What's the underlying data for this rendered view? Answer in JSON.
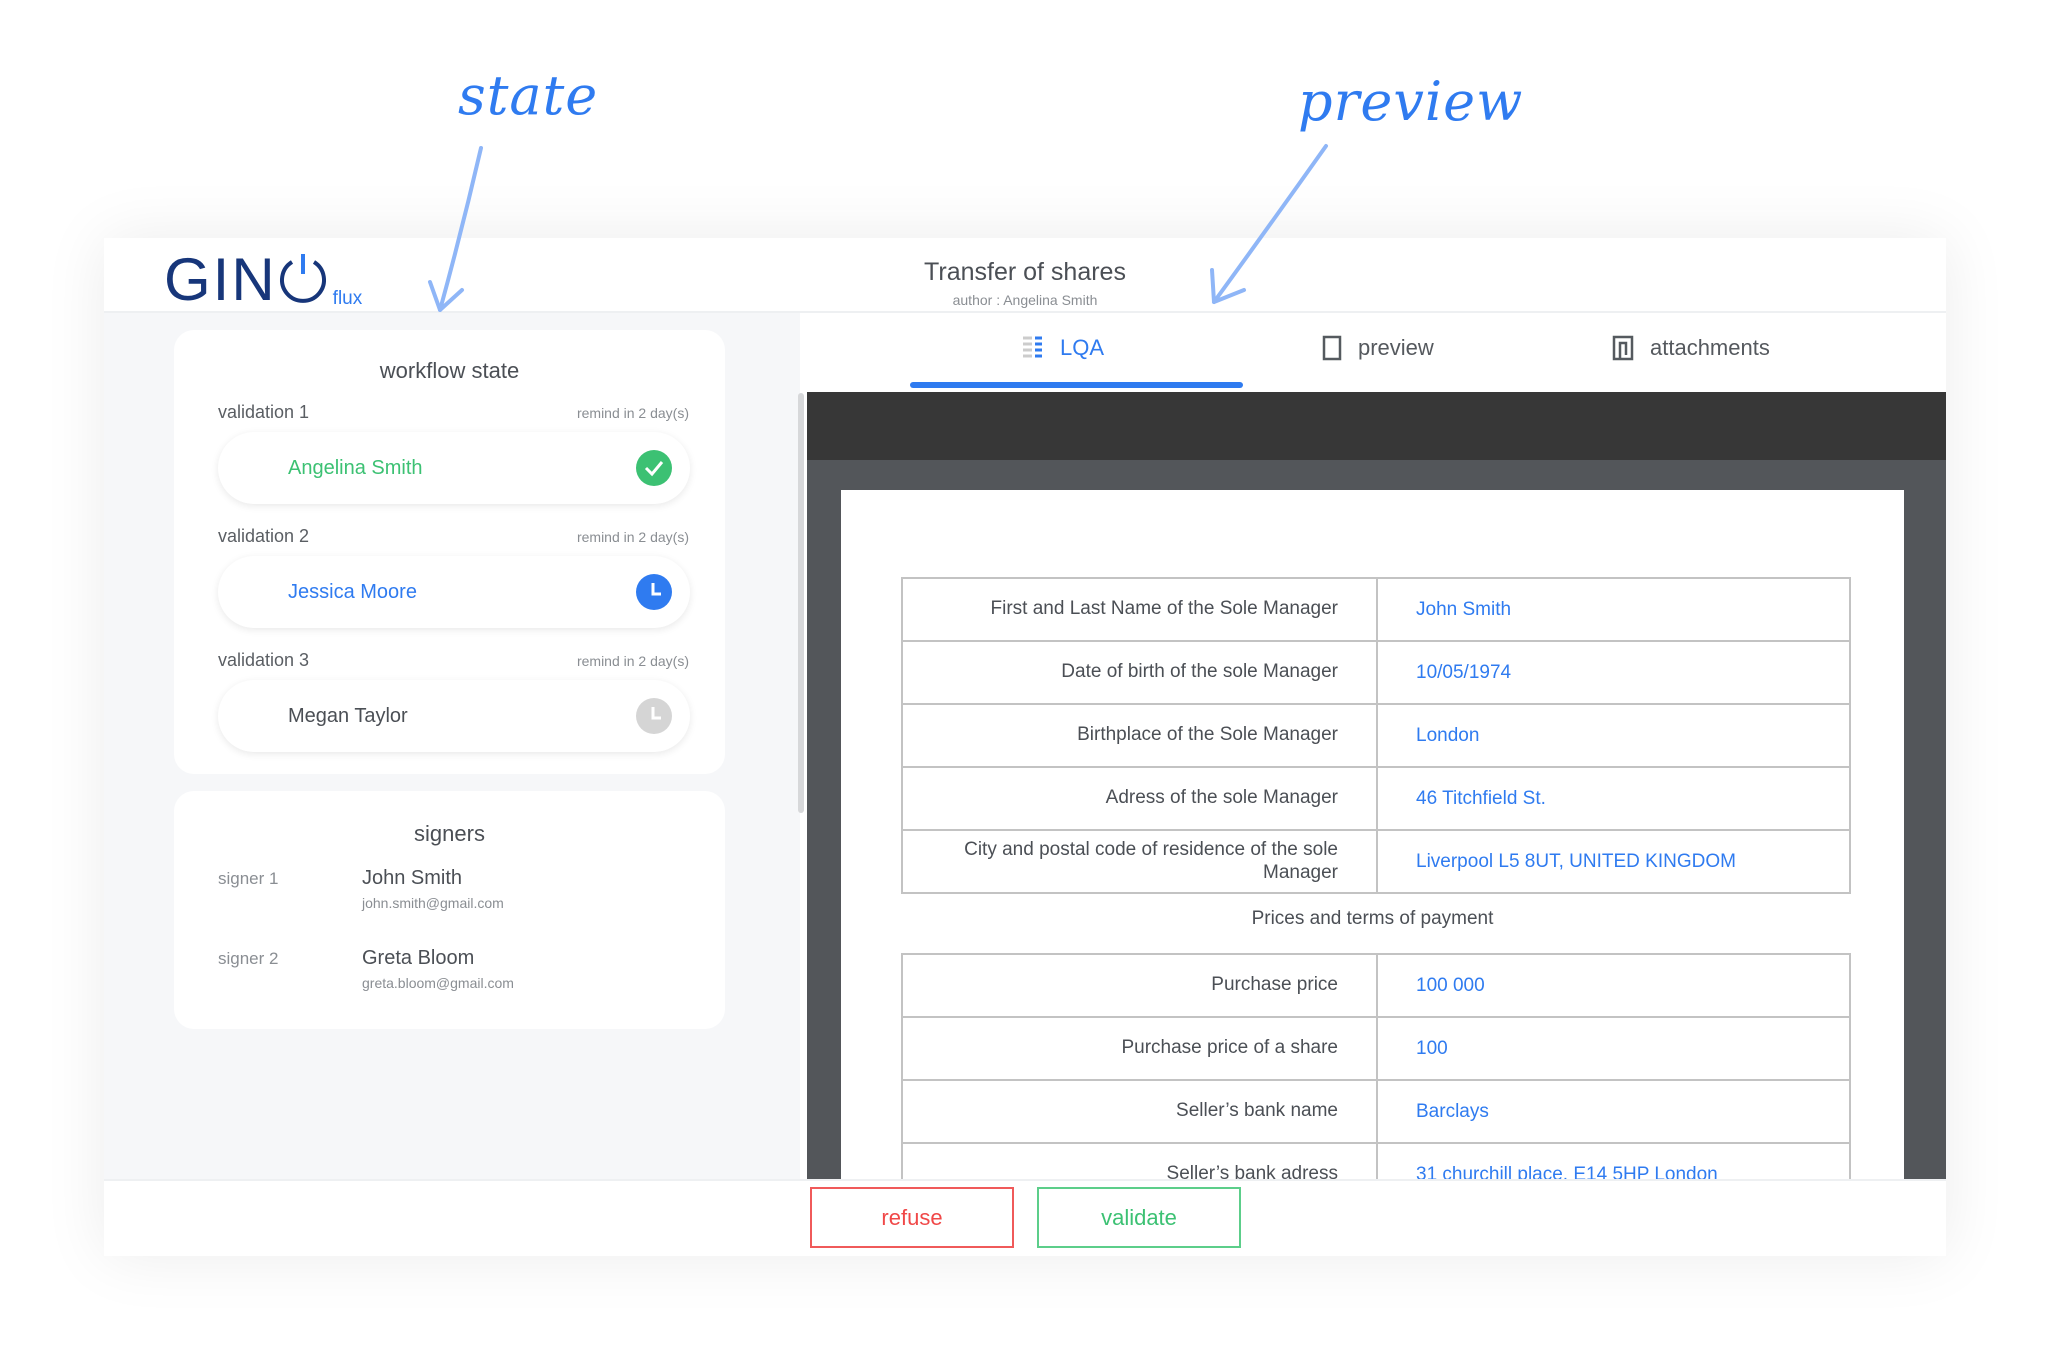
{
  "annotations": {
    "state": "state",
    "preview": "preview"
  },
  "header": {
    "logo": {
      "text": "GIN",
      "suffix": "flux",
      "power_icon": "power-icon"
    },
    "title": "Transfer of shares",
    "author": "author : Angelina Smith"
  },
  "workflow": {
    "title": "workflow state",
    "validations": [
      {
        "label": "validation 1",
        "remind": "remind in 2 day(s)",
        "name": "Angelina Smith",
        "status": "validated",
        "icon": "check-circle-icon",
        "color": "#3cc173"
      },
      {
        "label": "validation 2",
        "remind": "remind in 2 day(s)",
        "name": "Jessica Moore",
        "status": "pending",
        "icon": "clock-icon",
        "color": "#2f7bf0"
      },
      {
        "label": "validation 3",
        "remind": "remind in 2 day(s)",
        "name": "Megan Taylor",
        "status": "waiting",
        "icon": "clock-icon",
        "color": "#d5d5d5"
      }
    ]
  },
  "signers": {
    "title": "signers",
    "items": [
      {
        "label": "signer 1",
        "name": "John Smith",
        "email": "john.smith@gmail.com"
      },
      {
        "label": "signer 2",
        "name": "Greta Bloom",
        "email": "greta.bloom@gmail.com"
      }
    ]
  },
  "tabs": [
    {
      "label": "LQA",
      "icon": "list-icon",
      "active": true
    },
    {
      "label": "preview",
      "icon": "page-icon",
      "active": false
    },
    {
      "label": "attachments",
      "icon": "attachment-icon",
      "active": false
    }
  ],
  "document": {
    "manager_rows": [
      {
        "key": "First and Last Name of the Sole Manager",
        "value": "John Smith"
      },
      {
        "key": "Date of birth of the sole Manager",
        "value": "10/05/1974"
      },
      {
        "key": "Birthplace of the Sole Manager",
        "value": "London"
      },
      {
        "key": "Adress of the sole Manager",
        "value": "46 Titchfield St."
      },
      {
        "key": "City and postal code of residence of the sole Manager",
        "value": "Liverpool L5 8UT, UNITED KINGDOM"
      }
    ],
    "section": "Prices and terms of payment",
    "payment_rows": [
      {
        "key": "Purchase price",
        "value": "100 000"
      },
      {
        "key": "Purchase price of a share",
        "value": "100"
      },
      {
        "key": "Seller’s bank name",
        "value": "Barclays"
      },
      {
        "key": "Seller’s bank adress",
        "value": "31 churchill place, E14 5HP London"
      }
    ]
  },
  "footer": {
    "refuse": "refuse",
    "validate": "validate"
  },
  "colors": {
    "accent": "#2f7bf0",
    "success": "#3cc173",
    "danger": "#f04848",
    "logo": "#17367a"
  }
}
